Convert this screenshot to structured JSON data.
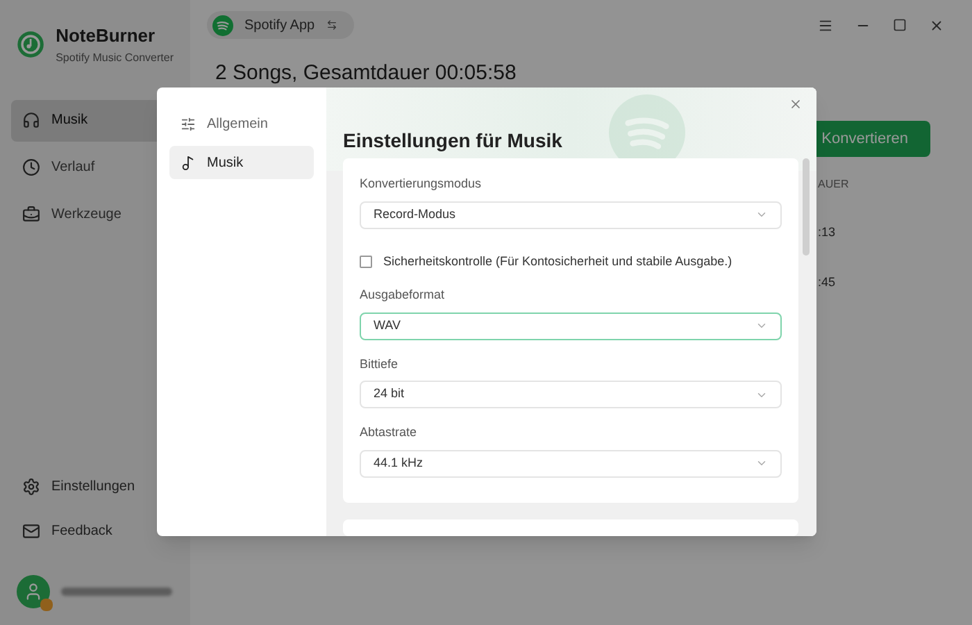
{
  "app": {
    "name": "NoteBurner",
    "subtitle": "Spotify Music Converter"
  },
  "sidebar": {
    "items": [
      {
        "label": "Musik",
        "selected": true
      },
      {
        "label": "Verlauf",
        "selected": false
      },
      {
        "label": "Werkzeuge",
        "selected": false
      }
    ],
    "bottom_items": [
      {
        "label": "Einstellungen"
      },
      {
        "label": "Feedback"
      }
    ]
  },
  "source_pill": {
    "label": "Spotify App"
  },
  "header": {
    "title": "2 Songs, Gesamtdauer 00:05:58",
    "convert_button": "Konvertieren"
  },
  "table": {
    "column_1": "AUER",
    "rows": [
      ":13",
      ":45"
    ]
  },
  "dialog": {
    "nav": [
      {
        "label": "Allgemein",
        "selected": false
      },
      {
        "label": "Musik",
        "selected": true
      }
    ],
    "title": "Einstellungen für Musik",
    "settings": [
      {
        "kind": "select",
        "label": "Konvertierungsmodus",
        "value": "Record-Modus",
        "focused": false
      },
      {
        "kind": "checkbox",
        "label": "Sicherheitskontrolle (Für Kontosicherheit und stabile Ausgabe.)",
        "checked": false
      },
      {
        "kind": "select",
        "label": "Ausgabeformat",
        "value": "WAV",
        "focused": true
      },
      {
        "kind": "select",
        "label": "Bittiefe",
        "value": "24 bit",
        "focused": false
      },
      {
        "kind": "select",
        "label": "Abtastrate",
        "value": "44.1 kHz",
        "focused": false
      }
    ]
  }
}
